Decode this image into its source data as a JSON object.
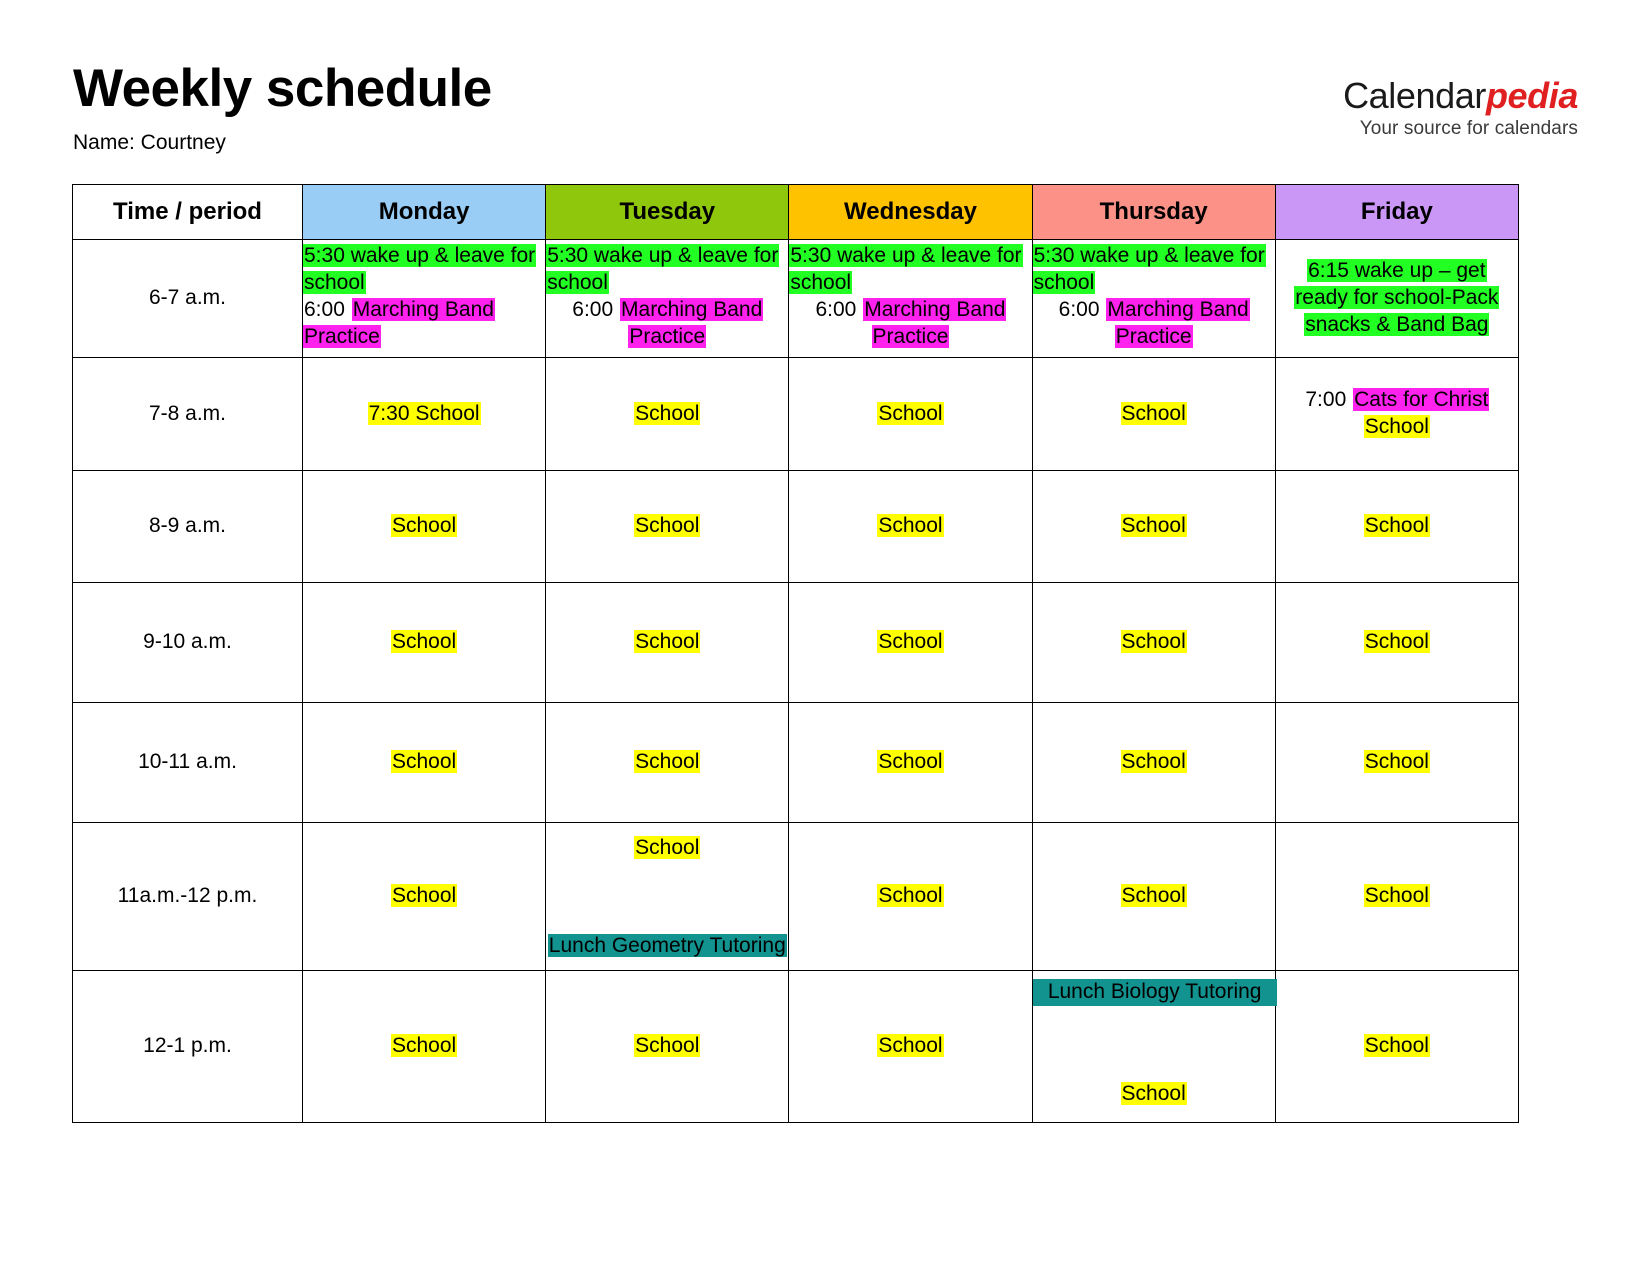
{
  "header": {
    "title": "Weekly schedule",
    "name_line": "Name: Courtney",
    "logo": {
      "part1": "Calendar",
      "part2": "pedia",
      "tagline": "Your source for calendars"
    }
  },
  "table": {
    "columns": [
      {
        "label": "Time / period",
        "color": "#ffffff"
      },
      {
        "label": "Monday",
        "color": "#9acdf5"
      },
      {
        "label": "Tuesday",
        "color": "#8fc70d"
      },
      {
        "label": "Wednesday",
        "color": "#ffc200"
      },
      {
        "label": "Thursday",
        "color": "#fc9287"
      },
      {
        "label": "Friday",
        "color": "#ca97f7"
      }
    ],
    "rows": [
      {
        "time": "6-7 a.m.",
        "monday": {
          "l1a": "5:30 wake up & leave for school",
          "l2a": "6:00 ",
          "l2b": "Marching Band Practice"
        },
        "tuesday": {
          "l1a": "5:30 wake up & leave for school",
          "l2a": "6:00 ",
          "l2b": "Marching Band Practice"
        },
        "wednesday": {
          "l1a": "5:30 wake up & leave for school",
          "l2a": "6:00 ",
          "l2b": "Marching Band Practice"
        },
        "thursday": {
          "l1a": "5:30 wake up & leave for school",
          "l2a": "6:00 ",
          "l2b": "Marching Band Practice"
        },
        "friday": {
          "l1a": "6:15 wake up – get ready for school-Pack snacks & Band Bag"
        }
      },
      {
        "time": "7-8 a.m.",
        "monday": {
          "l1a": "7:30 School"
        },
        "tuesday": {
          "l1a": "School"
        },
        "wednesday": {
          "l1a": "School"
        },
        "thursday": {
          "l1a": "School"
        },
        "friday": {
          "l1a": "7:00 ",
          "l1b": "Cats for Christ",
          "l2a": "School"
        }
      },
      {
        "time": "8-9 a.m.",
        "monday": {
          "l1a": "School"
        },
        "tuesday": {
          "l1a": "School"
        },
        "wednesday": {
          "l1a": "School"
        },
        "thursday": {
          "l1a": "School"
        },
        "friday": {
          "l1a": "School"
        }
      },
      {
        "time": "9-10 a.m.",
        "monday": {
          "l1a": "School"
        },
        "tuesday": {
          "l1a": "School"
        },
        "wednesday": {
          "l1a": "School"
        },
        "thursday": {
          "l1a": "School"
        },
        "friday": {
          "l1a": "School"
        }
      },
      {
        "time": "10-11 a.m.",
        "monday": {
          "l1a": "School"
        },
        "tuesday": {
          "l1a": "School"
        },
        "wednesday": {
          "l1a": "School"
        },
        "thursday": {
          "l1a": "School"
        },
        "friday": {
          "l1a": "School"
        }
      },
      {
        "time": "11a.m.-12 p.m.",
        "monday": {
          "l1a": "School"
        },
        "tuesday": {
          "l1a": "School",
          "l2a": "Lunch Geometry Tutoring"
        },
        "wednesday": {
          "l1a": "School"
        },
        "thursday": {
          "l1a": "School"
        },
        "friday": {
          "l1a": "School"
        }
      },
      {
        "time": "12-1 p.m.",
        "monday": {
          "l1a": "School"
        },
        "tuesday": {
          "l1a": "School"
        },
        "wednesday": {
          "l1a": "School"
        },
        "thursday": {
          "l1a": "Lunch Biology Tutoring",
          "l2a": "School"
        },
        "friday": {
          "l1a": "School"
        }
      }
    ]
  },
  "highlight_colors": {
    "green": "#22ff22",
    "yellow": "#ffff00",
    "pink": "#ff22ee",
    "teal": "#13938f"
  }
}
